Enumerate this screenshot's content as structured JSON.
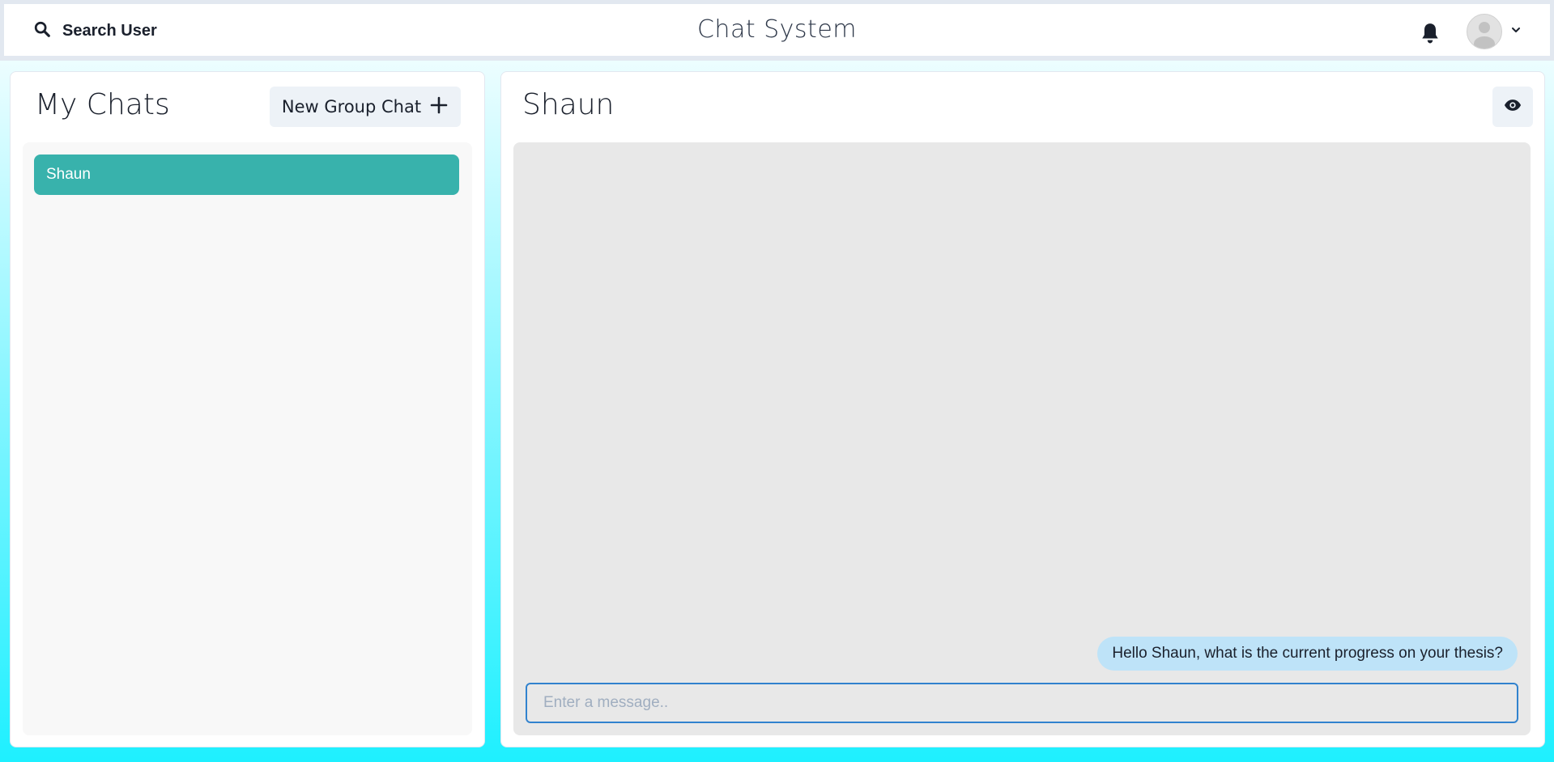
{
  "header": {
    "search_label": "Search User",
    "app_title": "Chat System",
    "icons": {
      "search": "search-icon",
      "notifications": "bell-icon",
      "profile": "avatar",
      "profile_menu": "chevron-down-icon"
    }
  },
  "sidebar": {
    "title": "My Chats",
    "new_group_label": "New Group Chat",
    "new_group_icon": "plus-icon",
    "chats": [
      {
        "name": "Shaun",
        "selected": true
      }
    ]
  },
  "chat": {
    "title": "Shaun",
    "view_profile_icon": "eye-icon",
    "messages": [
      {
        "text": "Hello Shaun, what is the current progress on your thesis?",
        "from_me": true
      }
    ],
    "input_placeholder": "Enter a message..",
    "input_value": ""
  },
  "colors": {
    "accent": "#38b2ac",
    "bubble_self": "#bee3f8",
    "input_border": "#3182ce",
    "button_bg": "#edf2f7"
  }
}
